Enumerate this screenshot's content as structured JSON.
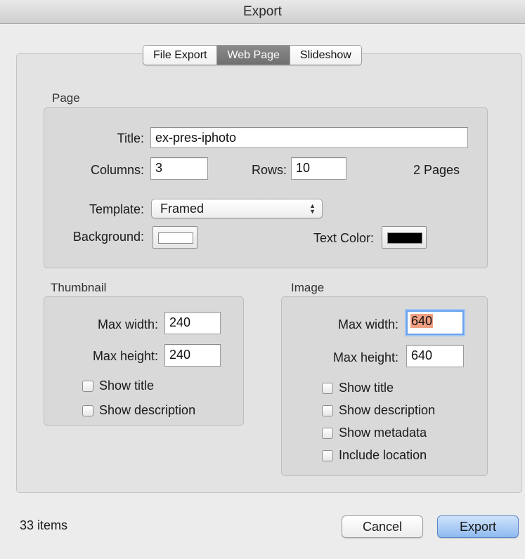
{
  "window": {
    "title": "Export"
  },
  "tabs": [
    {
      "label": "File Export",
      "active": false
    },
    {
      "label": "Web Page",
      "active": true
    },
    {
      "label": "Slideshow",
      "active": false
    }
  ],
  "page": {
    "section_label": "Page",
    "title_label": "Title:",
    "title_value": "ex-pres-iphoto",
    "columns_label": "Columns:",
    "columns_value": "3",
    "rows_label": "Rows:",
    "rows_value": "10",
    "pages_text": "2 Pages",
    "template_label": "Template:",
    "template_value": "Framed",
    "background_label": "Background:",
    "background_color": "#ffffff",
    "text_color_label": "Text Color:",
    "text_color": "#000000"
  },
  "thumbnail": {
    "section_label": "Thumbnail",
    "max_width_label": "Max width:",
    "max_width_value": "240",
    "max_height_label": "Max height:",
    "max_height_value": "240",
    "show_title_label": "Show title",
    "show_description_label": "Show description"
  },
  "image": {
    "section_label": "Image",
    "max_width_label": "Max width:",
    "max_width_value": "640",
    "max_height_label": "Max height:",
    "max_height_value": "640",
    "show_title_label": "Show title",
    "show_description_label": "Show description",
    "show_metadata_label": "Show metadata",
    "include_location_label": "Include location"
  },
  "footer": {
    "item_count": "33 items",
    "cancel_label": "Cancel",
    "export_label": "Export"
  }
}
